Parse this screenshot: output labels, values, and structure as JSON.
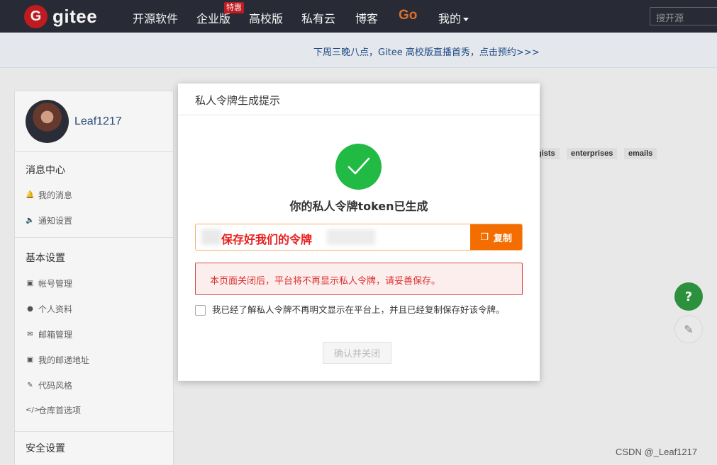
{
  "header": {
    "logo_text": "gitee",
    "nav": [
      {
        "label": "开源软件"
      },
      {
        "label": "企业版"
      },
      {
        "label": "高校版"
      },
      {
        "label": "私有云"
      },
      {
        "label": "博客"
      },
      {
        "label": "Go"
      },
      {
        "label": "我的"
      }
    ],
    "hot_badge": "特惠",
    "search_placeholder": "搜开源"
  },
  "announcement": {
    "text": "下周三晚八点，Gitee 高校版直播首秀，点击预约>>>"
  },
  "sidebar": {
    "username": "Leaf1217",
    "sections": [
      {
        "title": "消息中心",
        "items": [
          {
            "label": "我的消息",
            "icon": "bell-icon"
          },
          {
            "label": "通知设置",
            "icon": "speaker-icon"
          }
        ]
      },
      {
        "title": "基本设置",
        "items": [
          {
            "label": "帐号管理",
            "icon": "id-card-icon"
          },
          {
            "label": "个人资料",
            "icon": "user-icon"
          },
          {
            "label": "邮箱管理",
            "icon": "mail-icon"
          },
          {
            "label": "我的邮递地址",
            "icon": "address-card-icon"
          },
          {
            "label": "代码风格",
            "icon": "brush-icon"
          },
          {
            "label": "仓库首选项",
            "icon": "code-icon"
          }
        ]
      },
      {
        "title": "安全设置",
        "items": []
      }
    ]
  },
  "background_tags": [
    "gists",
    "enterprises",
    "emails"
  ],
  "modal": {
    "title": "私人令牌生成提示",
    "success_message": "你的私人令牌token已生成",
    "token_text": "保存好我们的令牌",
    "copy_label": "复制",
    "warning": "本页面关闭后，平台将不再显示私人令牌，请妥善保存。",
    "agree_text": "我已经了解私人令牌不再明文显示在平台上，并且已经复制保存好该令牌。",
    "confirm_label": "确认并关闭"
  },
  "floating": {
    "help_label": "?"
  },
  "watermark": "CSDN @_Leaf1217",
  "colors": {
    "navbar": "#2a2c38",
    "brand": "#c71d23",
    "success": "#21ba45",
    "copy": "#f36d00",
    "warning_text": "#d9302e"
  }
}
